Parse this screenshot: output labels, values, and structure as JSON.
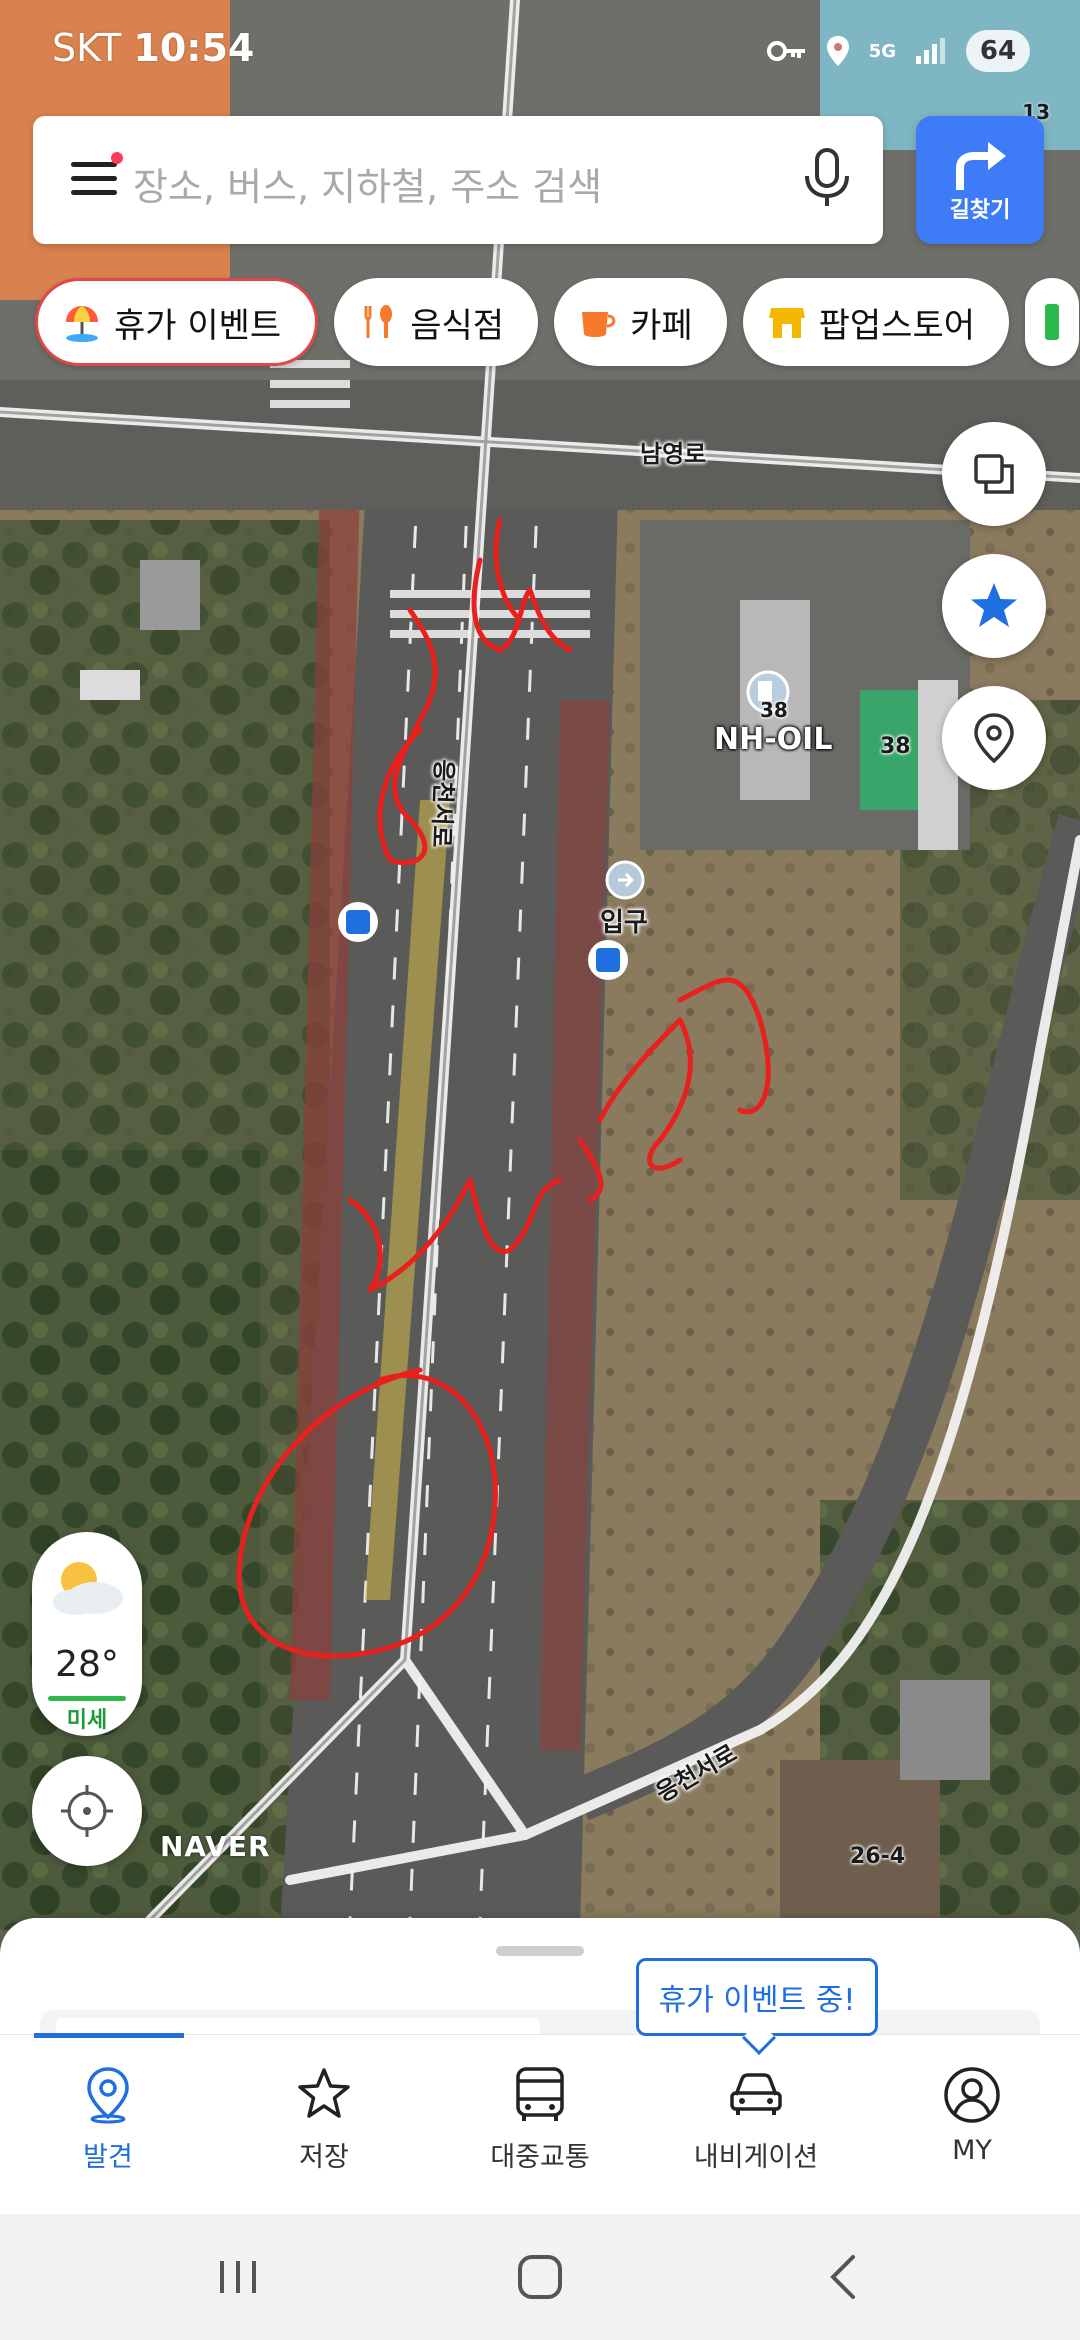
{
  "status_bar": {
    "carrier": "SKT",
    "time": "10:54",
    "network": "5G",
    "battery": "64",
    "corner_number": "13"
  },
  "search": {
    "placeholder": "장소, 버스, 지하철, 주소 검색",
    "route_label": "길찾기"
  },
  "chips": [
    {
      "label": "휴가 이벤트",
      "icon": "beach-umbrella-icon",
      "active": true
    },
    {
      "label": "음식점",
      "icon": "fork-spoon-icon",
      "active": false
    },
    {
      "label": "카페",
      "icon": "coffee-cup-icon",
      "active": false
    },
    {
      "label": "팝업스토어",
      "icon": "store-icon",
      "active": false
    }
  ],
  "map": {
    "road_labels": [
      "남영로",
      "응천서로",
      "응천서로"
    ],
    "poi": {
      "name": "NH-OIL",
      "price_badge": "38",
      "entrance": "입구"
    },
    "building_numbers": [
      "38",
      "26-4"
    ],
    "logo": "NAVER"
  },
  "weather": {
    "temperature": "28°",
    "dust_label": "미세"
  },
  "tooltip": "휴가 이벤트 중!",
  "bottom_nav": [
    {
      "label": "발견",
      "icon": "location-pin-icon",
      "active": true
    },
    {
      "label": "저장",
      "icon": "star-icon",
      "active": false
    },
    {
      "label": "대중교통",
      "icon": "bus-icon",
      "active": false
    },
    {
      "label": "내비게이션",
      "icon": "car-icon",
      "active": false
    },
    {
      "label": "MY",
      "icon": "profile-icon",
      "active": false
    }
  ],
  "colors": {
    "accent": "#3d7cf6",
    "nav_active": "#1f6fe0",
    "chip_active_border": "#e0464a",
    "annotation": "#e8201e",
    "dust_good": "#2db84c"
  }
}
